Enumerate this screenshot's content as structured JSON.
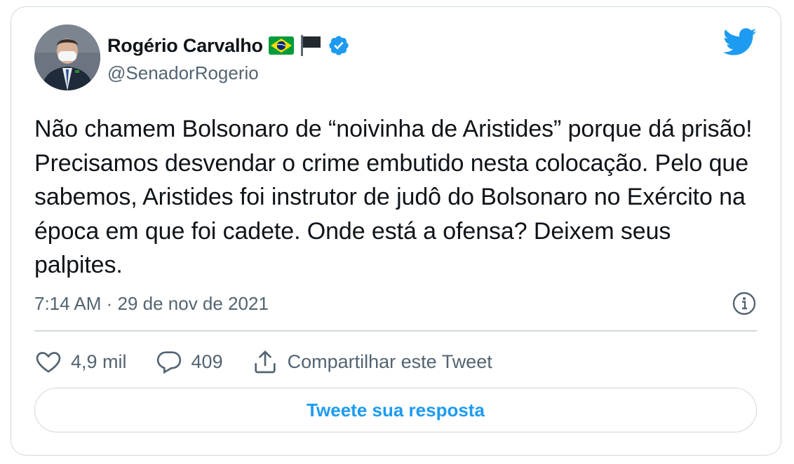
{
  "author": {
    "display_name": "Rogério Carvalho",
    "handle": "@SenadorRogerio",
    "avatar_icon": "profile-photo",
    "emojis": [
      "brazil-flag-icon",
      "black-flag-icon"
    ],
    "verified_icon": "verified-badge-icon"
  },
  "tweet": {
    "text": "Não chamem Bolsonaro de “noivinha de Aristides” porque dá prisão! Precisamos desvendar o crime embutido nesta colocação. Pelo que sabemos, Aristides foi instrutor de judô do Bolsonaro no Exército na época em que foi cadete. Onde está a ofensa? Deixem seus palpites.",
    "timestamp": "7:14 AM · 29 de nov de 2021"
  },
  "actions": {
    "likes": "4,9 mil",
    "replies": "409",
    "share_label": "Compartilhar este Tweet"
  },
  "reply_button_label": "Tweete sua resposta",
  "colors": {
    "accent": "#1d9bf0",
    "text": "#0f1419",
    "secondary": "#536471",
    "border": "#cfd9de"
  }
}
